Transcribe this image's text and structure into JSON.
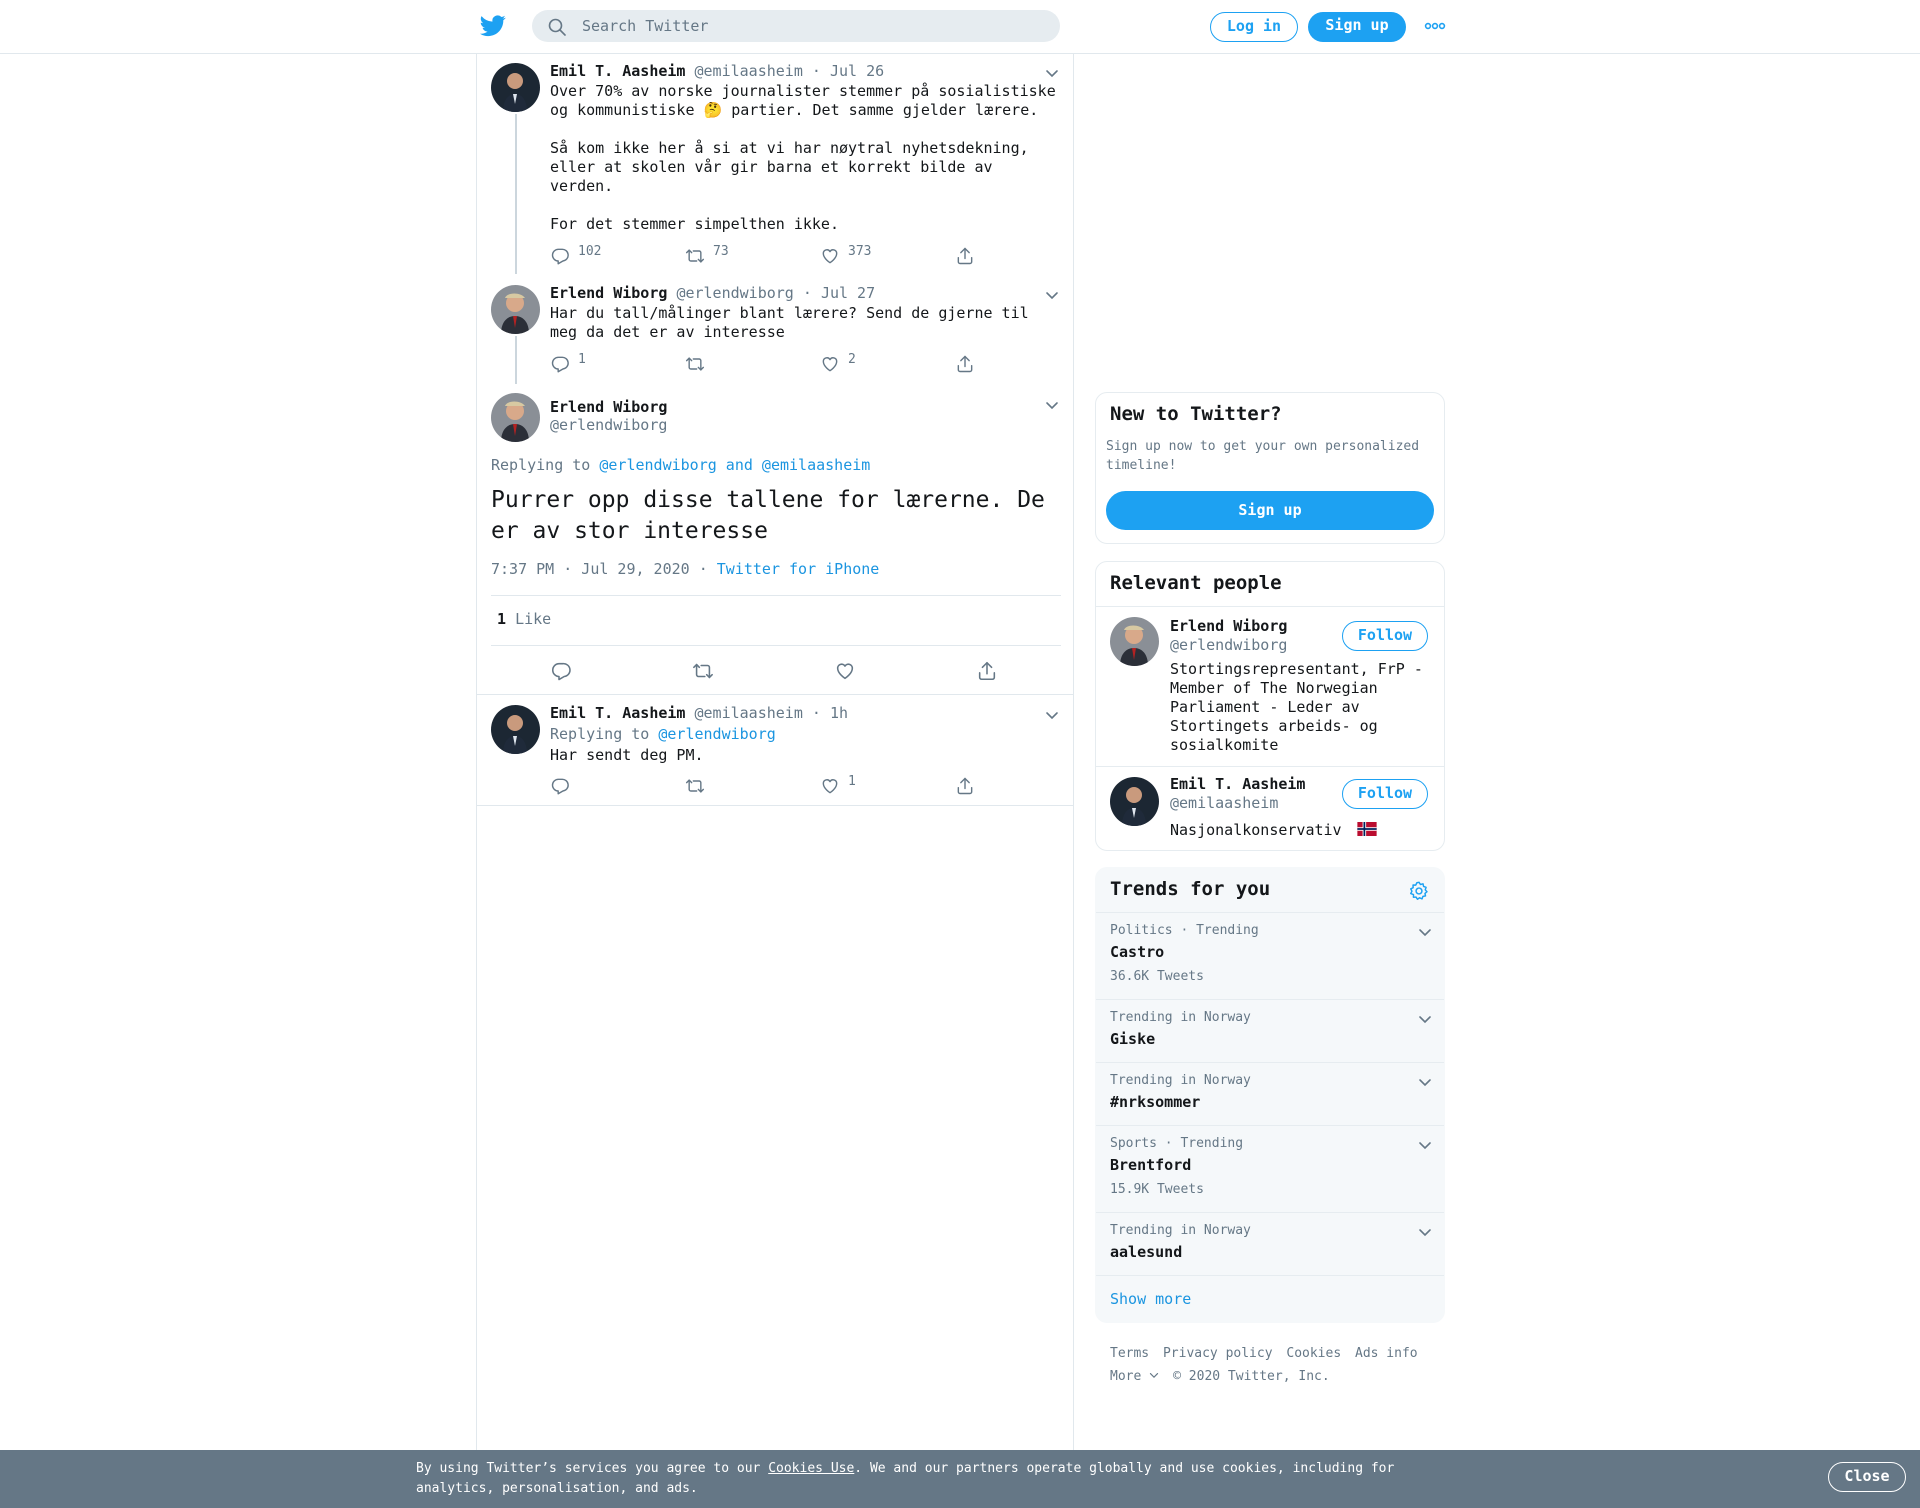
{
  "header": {
    "search_placeholder": "Search Twitter",
    "login_label": "Log in",
    "signup_label": "Sign up"
  },
  "colors": {
    "accent": "#1da1f2",
    "link": "#1b95e0",
    "muted": "#657786",
    "cookie_bar": "#657786"
  },
  "thread": [
    {
      "name": "Emil T. Aasheim",
      "handle": "@emilaasheim",
      "time": "Jul 26",
      "text": "Over 70% av norske journalister stemmer på sosialistiske\nog kommunistiske 🤔 partier. Det samme gjelder lærere.\n\nSå kom ikke her å si at vi har nøytral nyhetsdekning,\neller at skolen vår gir barna et korrekt bilde av\nverden.\n\nFor det stemmer simpelthen ikke.",
      "replies": "102",
      "retweets": "73",
      "likes": "373"
    },
    {
      "name": "Erlend Wiborg",
      "handle": "@erlendwiborg",
      "time": "Jul 27",
      "text": "Har du tall/målinger blant lærere? Send de gjerne til\nmeg da det er av interesse",
      "replies": "1",
      "retweets": "",
      "likes": "2"
    }
  ],
  "focus": {
    "name": "Erlend Wiborg",
    "handle": "@erlendwiborg",
    "replying_prefix": "Replying to",
    "replying_to": "@erlendwiborg and @emilaasheim",
    "text": "Purrer opp disse tallene for lærerne. De er av stor interesse",
    "timestamp": "7:37 PM · Jul 29, 2020",
    "source": "Twitter for iPhone",
    "like_count": "1",
    "like_label": "Like"
  },
  "reply": {
    "name": "Emil T. Aasheim",
    "handle": "@emilaasheim",
    "time": "1h",
    "replying_prefix": "Replying to",
    "replying_to": "@erlendwiborg",
    "text": "Har sendt deg PM.",
    "replies": "",
    "retweets": "",
    "likes": "1"
  },
  "sidebar": {
    "new_title": "New to Twitter?",
    "new_desc": "Sign up now to get your own personalized timeline!",
    "new_button": "Sign up",
    "relevant_title": "Relevant people",
    "people": [
      {
        "name": "Erlend Wiborg",
        "handle": "@erlendwiborg",
        "bio": "Stortingsrepresentant, FrP - Member of The Norwegian Parliament - Leder av Stortingets arbeids- og sosialkomite",
        "follow": "Follow"
      },
      {
        "name": "Emil T. Aasheim",
        "handle": "@emilaasheim",
        "bio": "Nasjonalkonservativ",
        "follow": "Follow"
      }
    ],
    "trends_title": "Trends for you",
    "trends": [
      {
        "context": "Politics · Trending",
        "name": "Castro",
        "count": "36.6K Tweets"
      },
      {
        "context": "Trending in Norway",
        "name": "Giske",
        "count": ""
      },
      {
        "context": "Trending in Norway",
        "name": "#nrksommer",
        "count": ""
      },
      {
        "context": "Sports · Trending",
        "name": "Brentford",
        "count": "15.9K Tweets"
      },
      {
        "context": "Trending in Norway",
        "name": "aalesund",
        "count": ""
      }
    ],
    "show_more": "Show more"
  },
  "footer": {
    "links": [
      "Terms",
      "Privacy policy",
      "Cookies",
      "Ads info"
    ],
    "more": "More",
    "copyright": "© 2020 Twitter, Inc."
  },
  "cookie": {
    "text_before": "By using Twitter’s services you agree to our ",
    "link": "Cookies Use",
    "text_after": ". We and our partners operate globally and use cookies, including for analytics, personalisation, and ads.",
    "close": "Close"
  }
}
